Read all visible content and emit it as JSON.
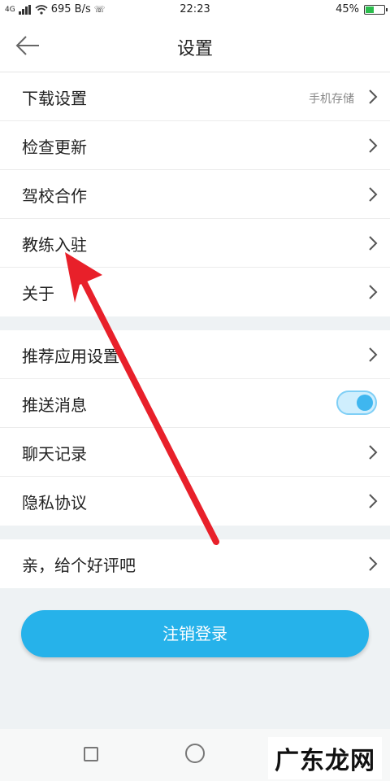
{
  "status_bar": {
    "network": "4G",
    "speed": "695 B/s",
    "time": "22:23",
    "battery": "45%",
    "battery_level": 0.45
  },
  "header": {
    "title": "设置"
  },
  "group1": [
    {
      "label": "下载设置",
      "value": "手机存储"
    },
    {
      "label": "检查更新"
    },
    {
      "label": "驾校合作"
    },
    {
      "label": "教练入驻"
    },
    {
      "label": "关于"
    }
  ],
  "group2": [
    {
      "label": "推荐应用设置"
    },
    {
      "label": "推送消息",
      "toggle_on": true
    },
    {
      "label": "聊天记录"
    },
    {
      "label": "隐私协议"
    }
  ],
  "group3": [
    {
      "label": "亲，给个好评吧"
    }
  ],
  "logout_label": "注销登录",
  "watermark": "广东龙网",
  "colors": {
    "accent": "#26b2ea",
    "annotation": "#e8202a"
  }
}
